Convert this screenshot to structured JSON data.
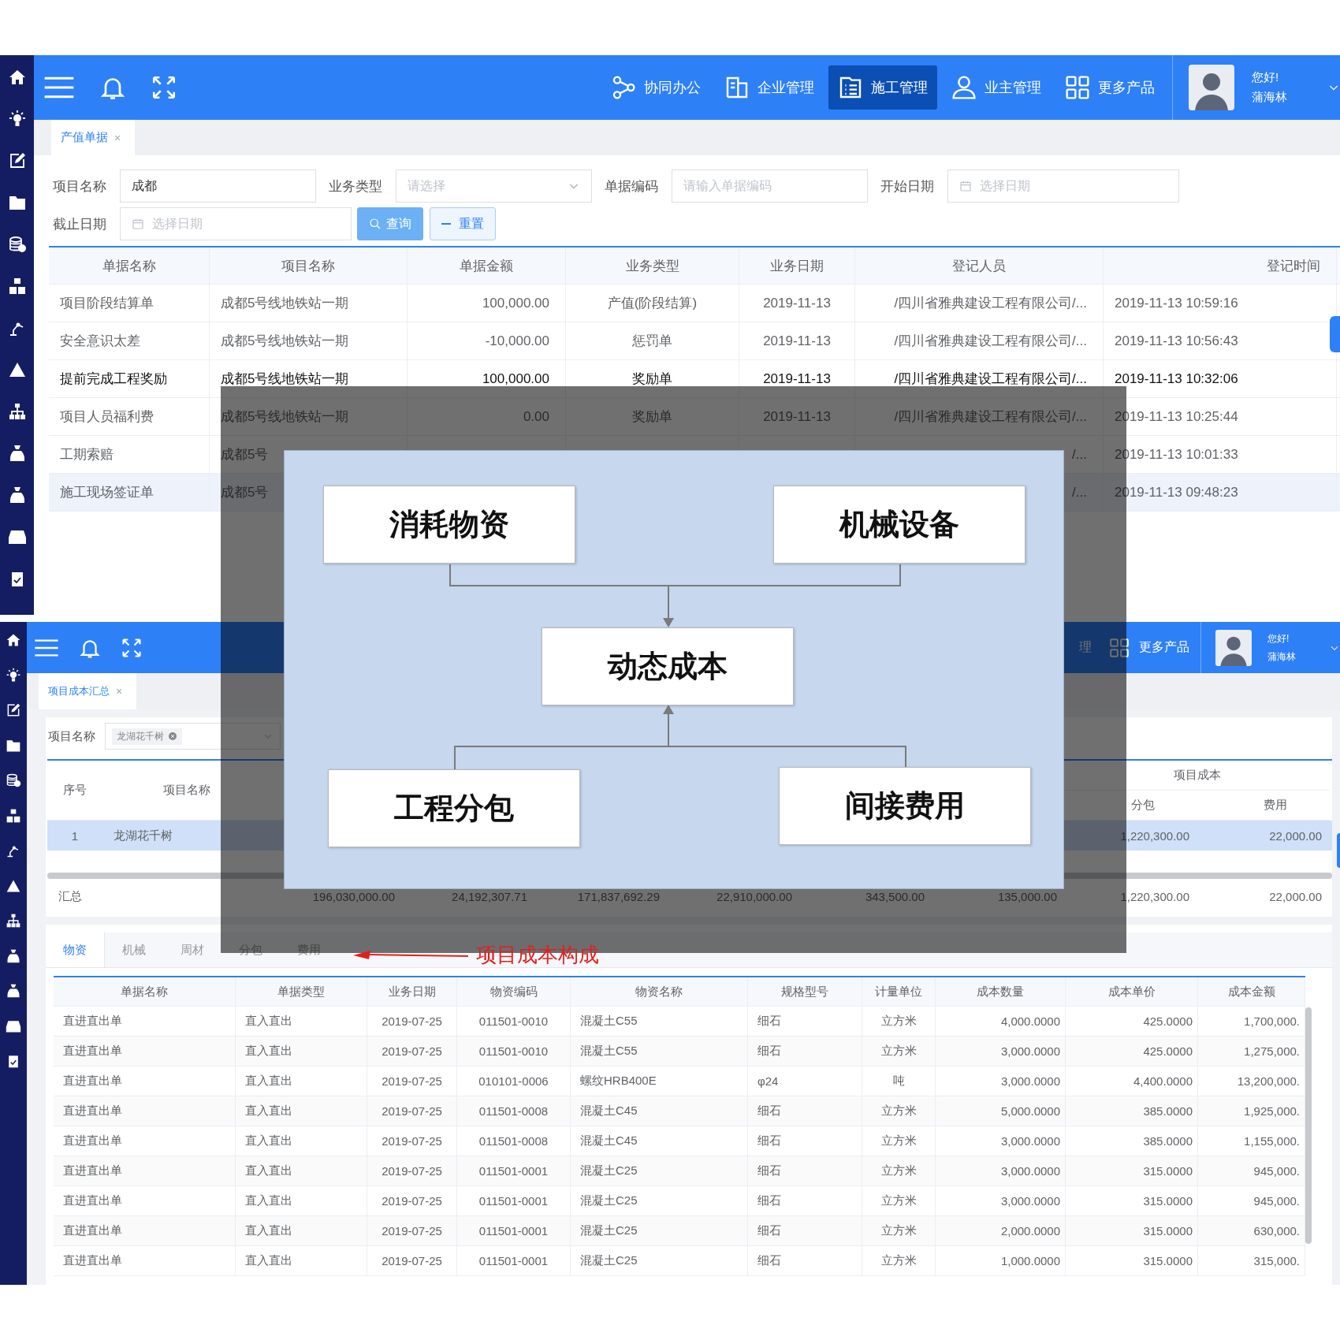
{
  "top_screen": {
    "header": {
      "nav": [
        {
          "label": "协同办公",
          "selected": false
        },
        {
          "label": "企业管理",
          "selected": false
        },
        {
          "label": "施工管理",
          "selected": true
        },
        {
          "label": "业主管理",
          "selected": false
        },
        {
          "label": "更多产品",
          "selected": false
        }
      ],
      "greeting": "您好!",
      "user": "蒲海林"
    },
    "tabs": [
      {
        "label": "产值单据",
        "close": "×",
        "selected": true
      }
    ],
    "filters": [
      {
        "label": "项目名称",
        "kind": "text",
        "value": "成都"
      },
      {
        "label": "业务类型",
        "kind": "select",
        "placeholder": "请选择"
      },
      {
        "label": "单据编码",
        "kind": "text",
        "placeholder": "请输入单据编码"
      },
      {
        "label": "开始日期",
        "kind": "date",
        "placeholder": "选择日期"
      },
      {
        "label": "截止日期",
        "kind": "date",
        "placeholder": "选择日期"
      }
    ],
    "buttons": [
      {
        "label": "查询",
        "kind": "primary"
      },
      {
        "label": "重置",
        "kind": "reset"
      }
    ],
    "table": {
      "columns": [
        "单据名称",
        "项目名称",
        "单据金额",
        "业务类型",
        "业务日期",
        "登记人员",
        "登记时间"
      ],
      "rows": [
        {
          "name": "项目阶段结算单",
          "project": "成都5号线地铁站一期",
          "amount": "100,000.00",
          "type": "产值(阶段结算)",
          "date": "2019-11-13",
          "person": "/四川省雅典建设工程有限公司/...",
          "time": "2019-11-13 10:59:16",
          "hovered": false,
          "selected": false
        },
        {
          "name": "安全意识太差",
          "project": "成都5号线地铁站一期",
          "amount": "-10,000.00",
          "type": "惩罚单",
          "date": "2019-11-13",
          "person": "/四川省雅典建设工程有限公司/...",
          "time": "2019-11-13 10:56:43",
          "hovered": false,
          "selected": false
        },
        {
          "name": "提前完成工程奖励",
          "project": "成都5号线地铁站一期",
          "amount": "100,000.00",
          "type": "奖励单",
          "date": "2019-11-13",
          "person": "/四川省雅典建设工程有限公司/...",
          "time": "2019-11-13 10:32:06",
          "hovered": true,
          "selected": false
        },
        {
          "name": "项目人员福利费",
          "project": "成都5号线地铁站一期",
          "amount": "0.00",
          "type": "奖励单",
          "date": "2019-11-13",
          "person": "/四川省雅典建设工程有限公司/...",
          "time": "2019-11-13 10:25:44",
          "hovered": false,
          "selected": false
        },
        {
          "name": "工期索赔",
          "project": "成都5号",
          "person": "/...",
          "time": "2019-11-13 10:01:33",
          "hovered": false,
          "selected": false
        },
        {
          "name": "施工现场签证单",
          "project": "成都5号",
          "person": "/...",
          "time": "2019-11-13 09:48:23",
          "hovered": false,
          "selected": true
        }
      ]
    }
  },
  "bottom_screen": {
    "header": {
      "nav": [
        {
          "label": "理",
          "selected": false
        },
        {
          "label": "更多产品",
          "selected": false
        }
      ],
      "greeting": "您好!",
      "user": "蒲海林"
    },
    "tabs": [
      {
        "label": "项目成本汇总",
        "close": "×",
        "selected": true
      }
    ],
    "filter": {
      "label": "项目名称",
      "tag": "龙湖花千树"
    },
    "summary_table": {
      "columns": [
        "序号",
        "项目名称"
      ],
      "group": "项目成本",
      "sub_columns": [
        "分包",
        "费用"
      ],
      "rows": [
        {
          "no": "1",
          "name": "龙湖花千树",
          "subcontract": "1,220,300.00",
          "expense": "22,000.00",
          "selected": true
        }
      ],
      "total": {
        "label": "汇总",
        "values": [
          "196,030,000.00",
          "24,192,307.71",
          "171,837,692.29",
          "22,910,000.00",
          "343,500.00",
          "135,000.00",
          "1,220,300.00",
          "22,000.00"
        ]
      }
    },
    "detail_tabs": [
      {
        "label": "物资",
        "selected": true
      },
      {
        "label": "机械",
        "selected": false
      },
      {
        "label": "周材",
        "selected": false
      },
      {
        "label": "分包",
        "selected": false
      },
      {
        "label": "费用",
        "selected": false
      }
    ],
    "detail_table": {
      "columns": [
        "单据名称",
        "单据类型",
        "业务日期",
        "物资编码",
        "物资名称",
        "规格型号",
        "计量单位",
        "成本数量",
        "成本单价",
        "成本金额"
      ],
      "rows": [
        [
          "直进直出单",
          "直入直出",
          "2019-07-25",
          "011501-0010",
          "混凝土C55",
          "细石",
          "立方米",
          "4,000.0000",
          "425.0000",
          "1,700,000."
        ],
        [
          "直进直出单",
          "直入直出",
          "2019-07-25",
          "011501-0010",
          "混凝土C55",
          "细石",
          "立方米",
          "3,000.0000",
          "425.0000",
          "1,275,000."
        ],
        [
          "直进直出单",
          "直入直出",
          "2019-07-25",
          "010101-0006",
          "螺纹HRB400E",
          "φ24",
          "吨",
          "3,000.0000",
          "4,400.0000",
          "13,200,000."
        ],
        [
          "直进直出单",
          "直入直出",
          "2019-07-25",
          "011501-0008",
          "混凝土C45",
          "细石",
          "立方米",
          "5,000.0000",
          "385.0000",
          "1,925,000."
        ],
        [
          "直进直出单",
          "直入直出",
          "2019-07-25",
          "011501-0008",
          "混凝土C45",
          "细石",
          "立方米",
          "3,000.0000",
          "385.0000",
          "1,155,000."
        ],
        [
          "直进直出单",
          "直入直出",
          "2019-07-25",
          "011501-0001",
          "混凝土C25",
          "细石",
          "立方米",
          "3,000.0000",
          "315.0000",
          "945,000."
        ],
        [
          "直进直出单",
          "直入直出",
          "2019-07-25",
          "011501-0001",
          "混凝土C25",
          "细石",
          "立方米",
          "3,000.0000",
          "315.0000",
          "945,000."
        ],
        [
          "直进直出单",
          "直入直出",
          "2019-07-25",
          "011501-0001",
          "混凝土C25",
          "细石",
          "立方米",
          "2,000.0000",
          "315.0000",
          "630,000."
        ],
        [
          "直进直出单",
          "直入直出",
          "2019-07-25",
          "011501-0001",
          "混凝土C25",
          "细石",
          "立方米",
          "1,000.0000",
          "315.0000",
          "315,000."
        ]
      ]
    }
  },
  "diagram": {
    "nodes": [
      {
        "label": "消耗物资"
      },
      {
        "label": "机械设备"
      },
      {
        "label": "动态成本"
      },
      {
        "label": "工程分包"
      },
      {
        "label": "间接费用"
      }
    ]
  },
  "annotation": {
    "label": "项目成本构成"
  }
}
